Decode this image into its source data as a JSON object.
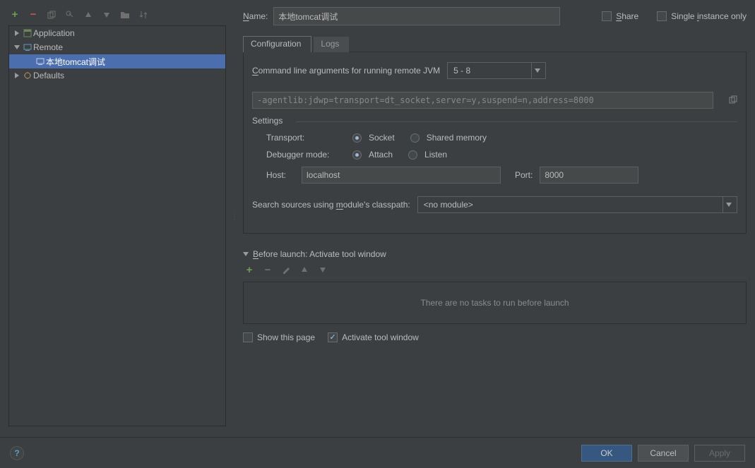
{
  "tree": {
    "application": "Application",
    "remote": "Remote",
    "config_name": "本地tomcat调试",
    "defaults": "Defaults"
  },
  "name_label": "Name:",
  "name_value": "本地tomcat调试",
  "share_label": "Share",
  "single_label": "Single instance only",
  "tabs": {
    "config": "Configuration",
    "logs": "Logs"
  },
  "cmdline_label": "Command line arguments for running remote JVM",
  "jvm_version": "5 - 8",
  "agent_args": "-agentlib:jdwp=transport=dt_socket,server=y,suspend=n,address=8000",
  "settings": {
    "title": "Settings",
    "transport_label": "Transport:",
    "socket": "Socket",
    "shared": "Shared memory",
    "debugger_label": "Debugger mode:",
    "attach": "Attach",
    "listen": "Listen",
    "host_label": "Host:",
    "host_value": "localhost",
    "port_label": "Port:",
    "port_value": "8000"
  },
  "module_label": "Search sources using module's classpath:",
  "module_value": "<no module>",
  "before": {
    "title": "Before launch: Activate tool window",
    "empty": "There are no tasks to run before launch",
    "show_page": "Show this page",
    "activate": "Activate tool window"
  },
  "buttons": {
    "ok": "OK",
    "cancel": "Cancel",
    "apply": "Apply"
  }
}
